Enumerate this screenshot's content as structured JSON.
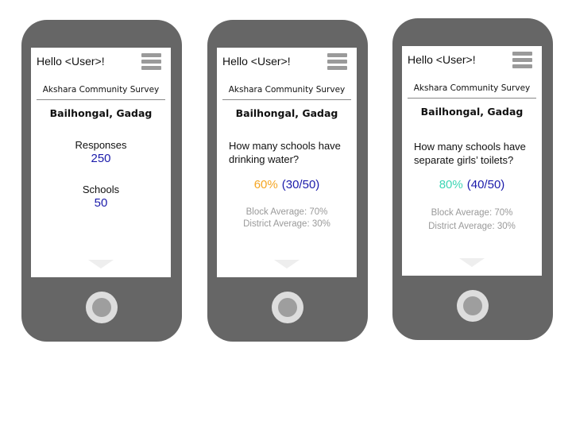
{
  "screens": [
    {
      "greeting": "Hello <User>!",
      "survey_title": "Akshara Community Survey",
      "location": "Bailhongal, Gadag",
      "responses_label": "Responses",
      "responses_value": "250",
      "schools_label": "Schools",
      "schools_value": "50"
    },
    {
      "greeting": "Hello <User>!",
      "survey_title": "Akshara Community Survey",
      "location": "Bailhongal, Gadag",
      "question": "How many schools have drinking water?",
      "percent": "60%",
      "fraction": "(30/50)",
      "block_average": "Block Average: 70%",
      "district_average": "District Average: 30%",
      "percent_color": "#f5a623"
    },
    {
      "greeting": "Hello <User>!",
      "survey_title": "Akshara Community Survey",
      "location": "Bailhongal, Gadag",
      "question": "How many schools have separate girls’ toilets?",
      "percent": "80%",
      "fraction": "(40/50)",
      "block_average": "Block Average: 70%",
      "district_average": "District Average: 30%",
      "percent_color": "#3dd6b5"
    }
  ],
  "icons": {
    "menu": "hamburger-menu-icon",
    "scroll": "scroll-down-arrow-icon",
    "home": "home-button-icon"
  },
  "colors": {
    "phone_body": "#666666",
    "value_blue": "#1a1aaa",
    "muted_gray": "#9a9a9a"
  }
}
